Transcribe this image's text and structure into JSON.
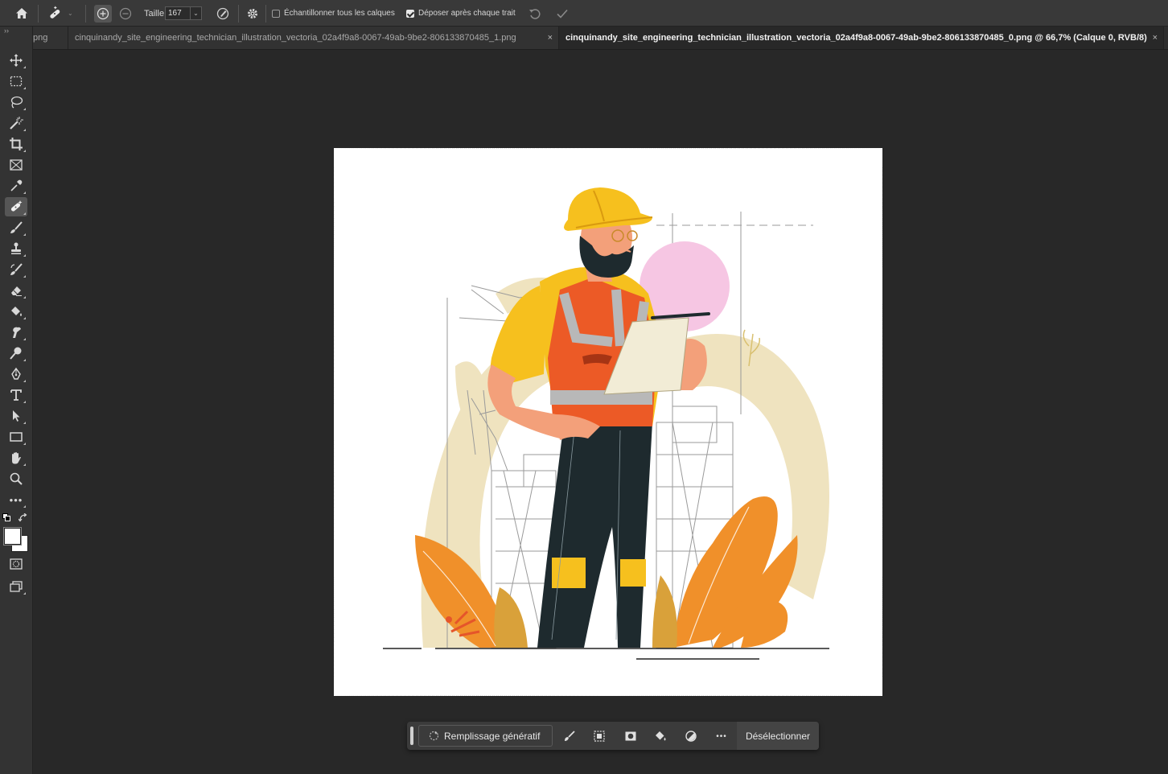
{
  "options_bar": {
    "size_label": "Taille",
    "size_value": "167",
    "sample_all_layers_label": "Échantillonner tous les calques",
    "sample_all_layers_checked": false,
    "drop_after_stroke_label": "Déposer après chaque trait",
    "drop_after_stroke_checked": true
  },
  "tabs": [
    {
      "label": "png",
      "active": false
    },
    {
      "label": "cinquinandy_site_engineering_technician_illustration_vectoria_02a4f9a8-0067-49ab-9be2-806133870485_1.png",
      "active": false
    },
    {
      "label": "cinquinandy_site_engineering_technician_illustration_vectoria_02a4f9a8-0067-49ab-9be2-806133870485_0.png @ 66,7% (Calque 0, RVB/8)",
      "active": true
    }
  ],
  "tab_close_glyph": "×",
  "taskbar": {
    "generative_fill_label": "Remplissage génératif",
    "deselect_label": "Désélectionner",
    "more_glyph": "•••"
  },
  "colors": {
    "accent_orange": "#f0902a",
    "helmet_yellow": "#f6c01e",
    "vest_orange": "#ec5a26",
    "pants_dark": "#1e2a2e",
    "beige_swoosh": "#efe3bf",
    "pink_circle": "#f6c6e3"
  }
}
